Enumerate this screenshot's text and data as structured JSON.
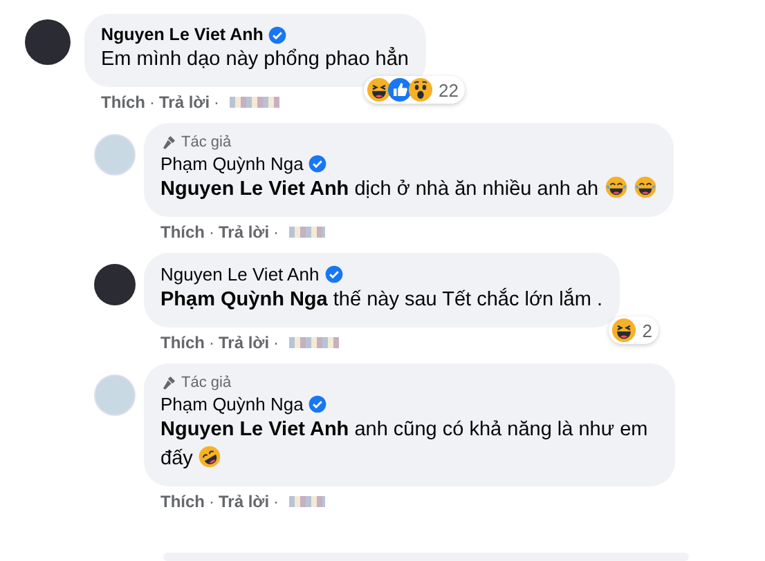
{
  "comments": [
    {
      "kind": "comment",
      "author": "Nguyen Le Viet Anh",
      "verified": true,
      "body": "Em mình dạo này phổng phao hẳn",
      "actions": [
        "Thích",
        "Trả lời"
      ],
      "separator": "·",
      "reactions": {
        "count": "22"
      }
    },
    {
      "kind": "reply",
      "badge": "Tác giả",
      "author": "Phạm Quỳnh Nga",
      "verified": true,
      "body": "**Nguyen Le Viet Anh** dịch ở nhà ăn nhiều anh ah",
      "actions": [
        "Thích",
        "Trả lời"
      ],
      "separator": "·"
    },
    {
      "kind": "reply",
      "author": "Nguyen Le Viet Anh",
      "verified": true,
      "body": "**Phạm Quỳnh Nga** thế này sau Tết chắc lớn lắm .",
      "actions": [
        "Thích",
        "Trả lời"
      ],
      "separator": "·",
      "reactions": {
        "count": "2"
      }
    },
    {
      "kind": "reply",
      "badge": "Tác giả",
      "author": "Phạm Quỳnh Nga",
      "verified": true,
      "body": "**Nguyen Le Viet Anh** anh cũng có khả năng là như em đấy",
      "actions": [
        "Thích",
        "Trả lời"
      ],
      "separator": "·"
    }
  ]
}
